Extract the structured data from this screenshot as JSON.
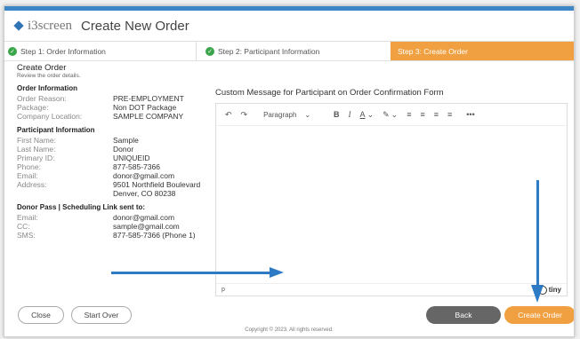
{
  "header": {
    "brand": "i3screen",
    "title": "Create New Order"
  },
  "steps": [
    {
      "label": "Step 1: Order Information",
      "status": "complete"
    },
    {
      "label": "Step 2: Participant Information",
      "status": "complete"
    },
    {
      "label": "Step 3: Create Order",
      "status": "active"
    }
  ],
  "summary": {
    "title": "Create Order",
    "subtitle": "Review the order details.",
    "order_info": {
      "heading": "Order Information",
      "rows": [
        {
          "label": "Order Reason:",
          "value": "PRE-EMPLOYMENT"
        },
        {
          "label": "Package:",
          "value": "Non DOT Package"
        },
        {
          "label": "Company Location:",
          "value": "SAMPLE COMPANY"
        }
      ]
    },
    "participant_info": {
      "heading": "Participant Information",
      "rows": [
        {
          "label": "First Name:",
          "value": "Sample"
        },
        {
          "label": "Last Name:",
          "value": "Donor"
        },
        {
          "label": "Primary ID:",
          "value": "UNIQUEID"
        },
        {
          "label": "Phone:",
          "value": "877-585-7366"
        },
        {
          "label": "Email:",
          "value": "donor@gmail.com"
        },
        {
          "label": "Address:",
          "value": "9501 Northfield Boulevard"
        },
        {
          "label": "",
          "value": "Denver, CO 80238"
        }
      ]
    },
    "donor_pass": {
      "heading": "Donor Pass | Scheduling Link sent to:",
      "rows": [
        {
          "label": "Email:",
          "value": "donor@gmail.com"
        },
        {
          "label": "CC:",
          "value": "sample@gmail.com"
        },
        {
          "label": "SMS:",
          "value": "877-585-7366 (Phone 1)"
        }
      ]
    }
  },
  "editor": {
    "title": "Custom Message for Participant on Order Confirmation Form",
    "format_select": "Paragraph",
    "status_path": "p",
    "brand": "tiny"
  },
  "buttons": {
    "close": "Close",
    "start_over": "Start Over",
    "back": "Back",
    "create": "Create Order"
  },
  "footer": "Copyright © 2023. All rights reserved.",
  "colors": {
    "accent": "#f0a040",
    "check": "#3aa64a",
    "arrow": "#2d7bc4",
    "back": "#666666"
  }
}
